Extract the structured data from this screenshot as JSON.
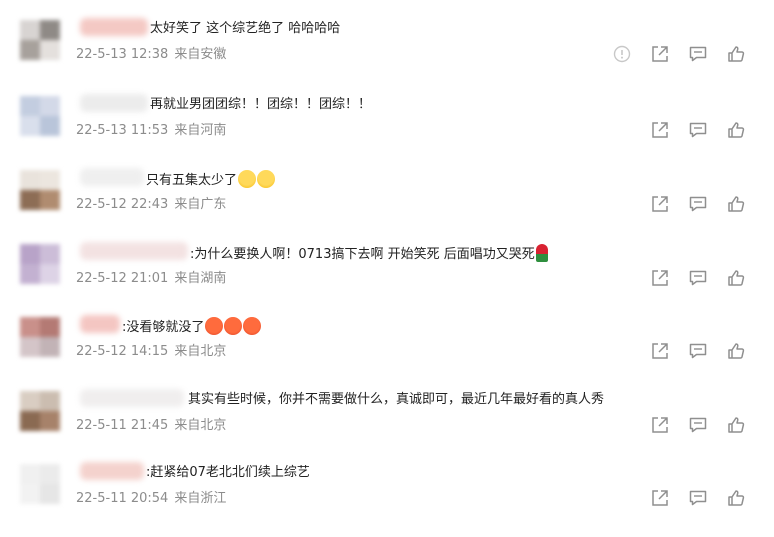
{
  "comments": [
    {
      "text": "太好笑了 这个综艺绝了 哈哈哈哈",
      "date": "22-5-13 12:38",
      "location": "来自安徽",
      "emojis": [],
      "show_report_icon": true
    },
    {
      "text": "再就业男团团综！！团综！！团综！！",
      "date": "22-5-13 11:53",
      "location": "来自河南",
      "emojis": []
    },
    {
      "text": "只有五集太少了",
      "date": "22-5-12 22:43",
      "location": "来自广东",
      "emojis": [
        "laugh-emoji",
        "laugh-emoji"
      ]
    },
    {
      "text": ":为什么要换人啊！0713搞下去啊 开始笑死 后面唱功又哭死",
      "date": "22-5-12 21:01",
      "location": "来自湖南",
      "emojis": [
        "rose-emoji"
      ]
    },
    {
      "text": ":没看够就没了",
      "date": "22-5-12 14:15",
      "location": "来自北京",
      "emojis": [
        "angry-emoji",
        "angry-emoji",
        "angry-emoji"
      ]
    },
    {
      "text": "其实有些时候，你并不需要做什么，真诚即可，最近几年最好看的真人秀",
      "date": "22-5-11 21:45",
      "location": "来自北京",
      "emojis": []
    },
    {
      "text": ":赶紧给07老北北们续上综艺",
      "date": "22-5-11 20:54",
      "location": "来自浙江",
      "emojis": []
    }
  ],
  "icons": {
    "report": "report-icon",
    "share": "share-icon",
    "reply": "comment-icon",
    "like": "like-icon"
  },
  "colors": {
    "text": "#222222",
    "meta": "#8c8c8c",
    "icon": "#8f8f8f"
  }
}
